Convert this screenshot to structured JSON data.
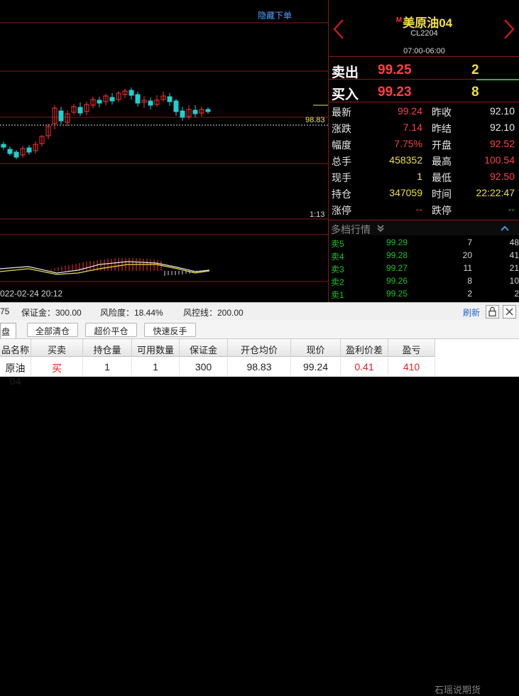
{
  "chart": {
    "hide_order_label": "隐藏下单",
    "price_line_label": "98.83",
    "ratio_label": "1:13",
    "date_label": "022-02-24 20:12",
    "candles": [
      {
        "o": 137,
        "c": 133,
        "h": 141,
        "l": 129
      },
      {
        "o": 130,
        "c": 124,
        "h": 134,
        "l": 121
      },
      {
        "o": 126,
        "c": 119,
        "h": 129,
        "l": 116
      },
      {
        "o": 122,
        "c": 131,
        "h": 135,
        "l": 118
      },
      {
        "o": 132,
        "c": 126,
        "h": 136,
        "l": 122
      },
      {
        "o": 128,
        "c": 137,
        "h": 141,
        "l": 124
      },
      {
        "o": 138,
        "c": 148,
        "h": 150,
        "l": 134
      },
      {
        "o": 149,
        "c": 162,
        "h": 166,
        "l": 144
      },
      {
        "o": 166,
        "c": 188,
        "h": 192,
        "l": 158
      },
      {
        "o": 184,
        "c": 170,
        "h": 190,
        "l": 165
      },
      {
        "o": 168,
        "c": 180,
        "h": 185,
        "l": 163
      },
      {
        "o": 182,
        "c": 190,
        "h": 194,
        "l": 179
      },
      {
        "o": 189,
        "c": 181,
        "h": 196,
        "l": 177
      },
      {
        "o": 183,
        "c": 193,
        "h": 197,
        "l": 178
      },
      {
        "o": 192,
        "c": 200,
        "h": 204,
        "l": 188
      },
      {
        "o": 199,
        "c": 195,
        "h": 204,
        "l": 189
      },
      {
        "o": 197,
        "c": 205,
        "h": 208,
        "l": 192
      },
      {
        "o": 203,
        "c": 198,
        "h": 209,
        "l": 193
      },
      {
        "o": 200,
        "c": 209,
        "h": 212,
        "l": 196
      },
      {
        "o": 207,
        "c": 212,
        "h": 215,
        "l": 202
      },
      {
        "o": 213,
        "c": 206,
        "h": 217,
        "l": 200
      },
      {
        "o": 207,
        "c": 195,
        "h": 211,
        "l": 190
      },
      {
        "o": 196,
        "c": 199,
        "h": 205,
        "l": 188
      },
      {
        "o": 198,
        "c": 192,
        "h": 203,
        "l": 186
      },
      {
        "o": 193,
        "c": 199,
        "h": 206,
        "l": 190
      },
      {
        "o": 200,
        "c": 205,
        "h": 211,
        "l": 197
      },
      {
        "o": 204,
        "c": 197,
        "h": 209,
        "l": 191
      },
      {
        "o": 198,
        "c": 183,
        "h": 201,
        "l": 177
      },
      {
        "o": 184,
        "c": 175,
        "h": 190,
        "l": 170
      },
      {
        "o": 176,
        "c": 186,
        "h": 192,
        "l": 172
      },
      {
        "o": 185,
        "c": 180,
        "h": 192,
        "l": 175
      },
      {
        "o": 181,
        "c": 186,
        "h": 190,
        "l": 176
      },
      {
        "o": 186,
        "c": 183,
        "h": 189,
        "l": 180
      }
    ]
  },
  "quote": {
    "marker": "M",
    "name": "美原油04",
    "code": "CL2204",
    "session": "07:00-06:00",
    "sell_label": "卖出",
    "sell_price": "99.25",
    "sell_vol": "2",
    "buy_label": "买入",
    "buy_price": "99.23",
    "buy_vol": "8",
    "stats_left": [
      {
        "k": "最新",
        "v": "99.24",
        "color": "#ff4040"
      },
      {
        "k": "涨跌",
        "v": "7.14",
        "color": "#ff4040"
      },
      {
        "k": "幅度",
        "v": "7.75%",
        "color": "#ff4040"
      },
      {
        "k": "总手",
        "v": "458352",
        "color": "#f0e040"
      },
      {
        "k": "现手",
        "v": "1",
        "color": "#f0e040"
      },
      {
        "k": "持仓",
        "v": "347059",
        "color": "#f0e040"
      },
      {
        "k": "涨停",
        "v": "--",
        "color": "#ff4040"
      }
    ],
    "stats_right": [
      {
        "k": "昨收",
        "v": "92.10",
        "color": "#e8e8e8"
      },
      {
        "k": "昨结",
        "v": "92.10",
        "color": "#e8e8e8"
      },
      {
        "k": "开盘",
        "v": "92.52",
        "color": "#ff4040"
      },
      {
        "k": "最高",
        "v": "100.54",
        "color": "#ff4040"
      },
      {
        "k": "最低",
        "v": "92.50",
        "color": "#ff4040"
      },
      {
        "k": "时间",
        "v": "22:22:47",
        "color": "#f0e040"
      },
      {
        "k": "跌停",
        "v": "--",
        "color": "#20c020"
      }
    ],
    "depth_title": "多档行情",
    "depth": [
      {
        "n": "卖5",
        "p": "99.29",
        "a": "7",
        "b": "48"
      },
      {
        "n": "卖4",
        "p": "99.28",
        "a": "20",
        "b": "41"
      },
      {
        "n": "卖3",
        "p": "99.27",
        "a": "11",
        "b": "21"
      },
      {
        "n": "卖2",
        "p": "99.26",
        "a": "8",
        "b": "10"
      },
      {
        "n": "卖1",
        "p": "99.25",
        "a": "2",
        "b": "2"
      }
    ]
  },
  "status": {
    "partial": "75",
    "margin": "保证金：300.00",
    "risk": "风险度：18.44%",
    "risk_line": "风控线：200.00",
    "refresh": "刷新"
  },
  "toolbar": {
    "tab_stub": "盘",
    "close_all": "全部清仓",
    "over_price_close": "超价平仓",
    "quick_reverse": "快速反手"
  },
  "positions": {
    "headers": [
      "品名称",
      "买卖",
      "持仓量",
      "可用数量",
      "保证金",
      "开仓均价",
      "现价",
      "盈利价差",
      "盈亏"
    ],
    "row": [
      "原油04",
      "买",
      "1",
      "1",
      "300",
      "98.83",
      "99.24",
      "0.41",
      "410"
    ],
    "watermark": "石瑶说期货"
  }
}
